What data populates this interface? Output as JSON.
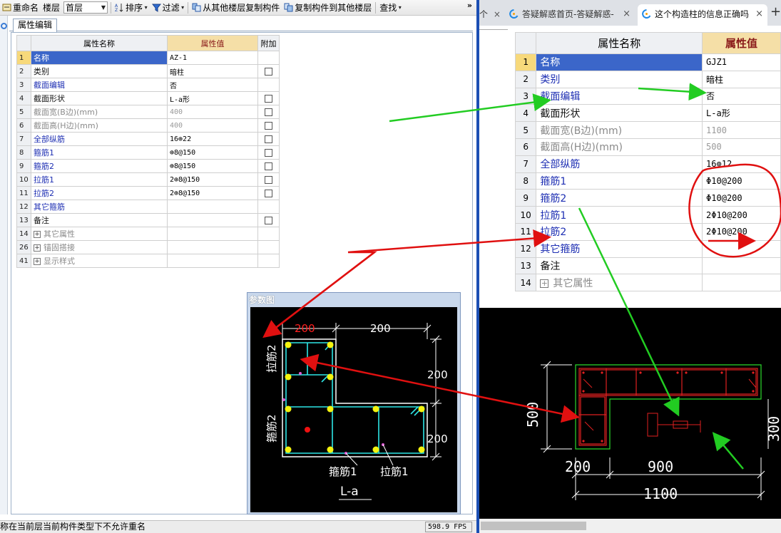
{
  "toolbar": {
    "rename": "重命名",
    "floor_label": "楼层",
    "floor_value": "首层",
    "sort": "排序",
    "filter": "过滤",
    "copy_from": "从其他楼层复制构件",
    "copy_to": "复制构件到其他楼层",
    "find": "查找",
    "more": "»"
  },
  "tab": {
    "label": "属性编辑"
  },
  "left_table": {
    "headers": [
      "属性名称",
      "属性值",
      "附加"
    ],
    "rows": [
      {
        "num": "1",
        "name": "名称",
        "value": "AZ-1",
        "style": "black",
        "check": false,
        "plus": false
      },
      {
        "num": "2",
        "name": "类别",
        "value": "暗柱",
        "style": "black",
        "check": true,
        "plus": false
      },
      {
        "num": "3",
        "name": "截面编辑",
        "value": "否",
        "style": "blue",
        "check": false,
        "plus": false
      },
      {
        "num": "4",
        "name": "截面形状",
        "value": "L-a形",
        "style": "black",
        "check": true,
        "plus": false
      },
      {
        "num": "5",
        "name": "截面宽(B边)(mm)",
        "value": "400",
        "style": "gray",
        "check": true,
        "plus": false
      },
      {
        "num": "6",
        "name": "截面高(H边)(mm)",
        "value": "400",
        "style": "gray",
        "check": true,
        "plus": false
      },
      {
        "num": "7",
        "name": "全部纵筋",
        "value": "16⊕22",
        "style": "blue",
        "check": true,
        "plus": false
      },
      {
        "num": "8",
        "name": "箍筋1",
        "value": "⊕8@150",
        "style": "blue",
        "check": true,
        "plus": false
      },
      {
        "num": "9",
        "name": "箍筋2",
        "value": "⊕8@150",
        "style": "blue",
        "check": true,
        "plus": false
      },
      {
        "num": "10",
        "name": "拉筋1",
        "value": "2⊕8@150",
        "style": "blue",
        "check": true,
        "plus": false
      },
      {
        "num": "11",
        "name": "拉筋2",
        "value": "2⊕8@150",
        "style": "blue",
        "check": true,
        "plus": false
      },
      {
        "num": "12",
        "name": "其它箍筋",
        "value": "",
        "style": "blue",
        "check": false,
        "plus": false
      },
      {
        "num": "13",
        "name": "备注",
        "value": "",
        "style": "black",
        "check": true,
        "plus": false
      },
      {
        "num": "14",
        "name": "其它属性",
        "value": "",
        "style": "gray",
        "check": false,
        "plus": true
      },
      {
        "num": "26",
        "name": "锚固搭接",
        "value": "",
        "style": "gray",
        "check": false,
        "plus": true
      },
      {
        "num": "41",
        "name": "显示样式",
        "value": "",
        "style": "gray",
        "check": false,
        "plus": true
      }
    ]
  },
  "param_window": {
    "title": "参数图",
    "dim_top_left": "200",
    "dim_top_right": "200",
    "dim_right_upper": "200",
    "dim_right_lower": "200",
    "label_tie2": "拉筋2",
    "label_stirrup2": "箍筋2",
    "label_stirrup1": "箍筋1",
    "label_tie1": "拉筋1",
    "shape_name": "L-a"
  },
  "status": {
    "text": "称在当前层当前构件类型下不允许重名",
    "fps": "598.9 FPS"
  },
  "browser": {
    "tab0": "个",
    "tab1": "答疑解惑首页-答疑解惑-",
    "tab2": "这个构造柱的信息正确吗",
    "close": "×",
    "new_tab": "+"
  },
  "right_table": {
    "headers": [
      "属性名称",
      "属性值"
    ],
    "rows": [
      {
        "num": "1",
        "name": "名称",
        "value": "GJZ1",
        "style": "black",
        "plus": false
      },
      {
        "num": "2",
        "name": "类别",
        "value": "暗柱",
        "style": "blue",
        "plus": false
      },
      {
        "num": "3",
        "name": "截面编辑",
        "value": "否",
        "style": "blue",
        "plus": false
      },
      {
        "num": "4",
        "name": "截面形状",
        "value": "L-a形",
        "style": "black",
        "plus": false
      },
      {
        "num": "5",
        "name": "截面宽(B边)(mm)",
        "value": "1100",
        "style": "gray",
        "plus": false
      },
      {
        "num": "6",
        "name": "截面高(H边)(mm)",
        "value": "500",
        "style": "gray",
        "plus": false
      },
      {
        "num": "7",
        "name": "全部纵筋",
        "value": "16⊕12",
        "style": "blue",
        "plus": false
      },
      {
        "num": "8",
        "name": "箍筋1",
        "value": "Φ10@200",
        "style": "blue",
        "plus": false
      },
      {
        "num": "9",
        "name": "箍筋2",
        "value": "Φ10@200",
        "style": "blue",
        "plus": false
      },
      {
        "num": "10",
        "name": "拉筋1",
        "value": "2Φ10@200",
        "style": "blue",
        "plus": false
      },
      {
        "num": "11",
        "name": "拉筋2",
        "value": "2Φ10@200",
        "style": "blue",
        "plus": false
      },
      {
        "num": "12",
        "name": "其它箍筋",
        "value": "",
        "style": "blue",
        "plus": false
      },
      {
        "num": "13",
        "name": "备注",
        "value": "",
        "style": "black",
        "plus": false
      },
      {
        "num": "14",
        "name": "其它属性",
        "value": "",
        "style": "gray",
        "plus": true
      }
    ]
  },
  "cad": {
    "dim_500": "500",
    "dim_300": "300",
    "dim_200": "200",
    "dim_900": "900",
    "dim_1100": "1100"
  },
  "colors": {
    "accent_blue": "#3b66c9",
    "header_value_bg": "#f5dfa7",
    "annotation_red": "#e01010",
    "annotation_green": "#22cc22"
  }
}
